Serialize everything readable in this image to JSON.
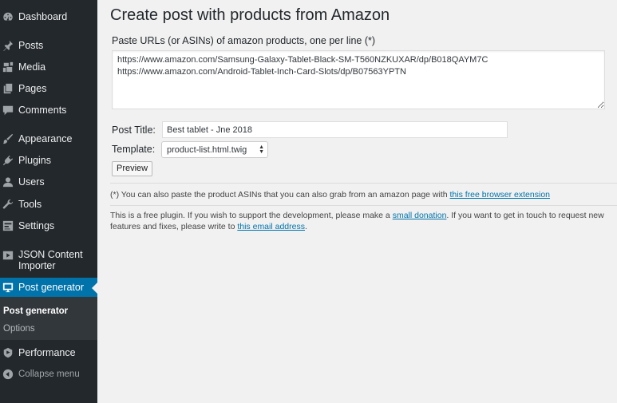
{
  "sidebar": {
    "items": [
      {
        "label": "Dashboard",
        "icon": "dashboard-icon"
      },
      {
        "label": "Posts",
        "icon": "pin-icon"
      },
      {
        "label": "Media",
        "icon": "media-icon"
      },
      {
        "label": "Pages",
        "icon": "pages-icon"
      },
      {
        "label": "Comments",
        "icon": "comment-icon"
      },
      {
        "label": "Appearance",
        "icon": "brush-icon"
      },
      {
        "label": "Plugins",
        "icon": "plugin-icon"
      },
      {
        "label": "Users",
        "icon": "user-icon"
      },
      {
        "label": "Tools",
        "icon": "wrench-icon"
      },
      {
        "label": "Settings",
        "icon": "settings-icon"
      },
      {
        "label": "JSON Content Importer",
        "icon": "video-icon"
      },
      {
        "label": "Post generator",
        "icon": "monitor-icon"
      },
      {
        "label": "Performance",
        "icon": "performance-icon"
      },
      {
        "label": "Collapse menu",
        "icon": "collapse-icon"
      }
    ],
    "submenu": [
      {
        "label": "Post generator"
      },
      {
        "label": "Options"
      }
    ],
    "colors": {
      "background": "#23282d",
      "active": "#0073aa",
      "submenu": "#32373c"
    }
  },
  "main": {
    "title": "Create post with products from Amazon",
    "urls_label": "Paste URLs (or ASINs) of amazon products, one per line (*)",
    "urls_value": "https://www.amazon.com/Samsung-Galaxy-Tablet-Black-SM-T560NZKUXAR/dp/B018QAYM7C\nhttps://www.amazon.com/Android-Tablet-Inch-Card-Slots/dp/B07563YPTN",
    "post_title_label": "Post Title:",
    "post_title_value": "Best tablet - Jne 2018",
    "template_label": "Template:",
    "template_value": "product-list.html.twig",
    "preview_label": "Preview",
    "note_asin": {
      "text": "(*) You can also paste the product ASINs that you can also grab from an amazon page with ",
      "link": "this free browser extension"
    },
    "note_support": {
      "text1": "This is a free plugin. If you wish to support the development, please make a ",
      "link1": "small donation",
      "text2": ". If you want to get in touch to request new features and fixes, please write to ",
      "link2": "this email address",
      "text3": "."
    }
  }
}
